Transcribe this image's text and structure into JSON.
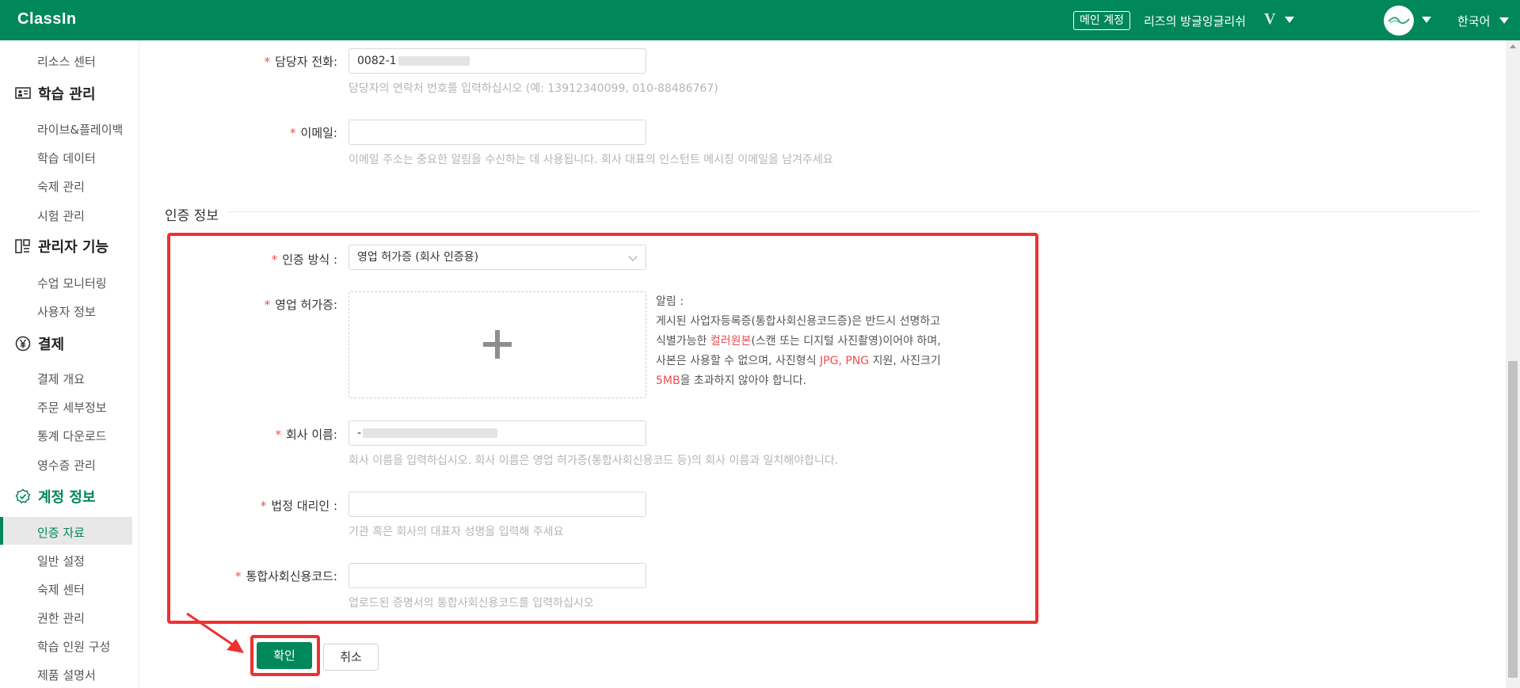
{
  "header": {
    "logo": "ClassIn",
    "main_account_badge": "메인 계정",
    "account_name": "리즈의 방글잉글리쉬",
    "account_level": "V",
    "language": "한국어"
  },
  "sidebar": {
    "top_item": "리소스 센터",
    "groups": [
      {
        "title": "학습 관리",
        "icon": "classroom-icon",
        "items": [
          "라이브&플레이백",
          "학습 데이터",
          "숙제 관리",
          "시험 관리"
        ]
      },
      {
        "title": "관리자 기능",
        "icon": "admin-tools-icon",
        "items": [
          "수업 모니터링",
          "사용자 정보"
        ]
      },
      {
        "title": "결제",
        "icon": "yen-icon",
        "items": [
          "결제 개요",
          "주문 세부정보",
          "통계 다운로드",
          "영수증 관리"
        ]
      },
      {
        "title": "계정 정보",
        "icon": "account-shield-icon",
        "items": [
          "인증 자료",
          "일반 설정",
          "숙제 센터",
          "권한 관리",
          "학습 인원 구성",
          "제품 설명서"
        ]
      }
    ],
    "active_item": "인증 자료"
  },
  "form": {
    "contact_phone": {
      "label": "담당자 전화:",
      "value": "0082-1",
      "hint": "담당자의 연락처 번호를 입력하십시오 (예: 13912340099, 010-88486767)"
    },
    "email": {
      "label": "이메일:",
      "value": "",
      "hint": "이메일 주소는 중요한 알림을 수신하는 데 사용됩니다. 회사 대표의 인스턴트 메시징 이메일을 남겨주세요"
    },
    "section_title": "인증 정보",
    "auth_method": {
      "label": "인증 방식 :",
      "value": "영업 허가증 (회사 인증용)"
    },
    "business_license": {
      "label": "영업 허가증:",
      "notice_title": "알림 :",
      "notice_line1": "게시된 사업자등록증(통합사회신용코드증)은 반드시 선명하고",
      "notice_line2_pre": "식별가능한 ",
      "notice_line2_hl": "컬러원본",
      "notice_line2_post": "(스캔 또는 디지털 사진촬영)이어야 하며,",
      "notice_line3_pre": "사본은 사용할 수 없으며, 사진형식 ",
      "notice_line3_hl": "JPG, PNG",
      "notice_line3_post": " 지원, 사진크기",
      "notice_line4_hl": "5MB",
      "notice_line4_post": "을 초과하지 않아야 합니다."
    },
    "company_name": {
      "label": "회사 이름:",
      "value": "-",
      "hint": "회사 이름을 입력하십시오. 회사 이름은 영업 허가증(통합사회신용코드 등)의 회사 이름과 일치해야합니다."
    },
    "legal_rep": {
      "label": "법정 대리인 :",
      "value": "",
      "hint": "기관 혹은 회사의 대표자 성명을 입력해 주세요"
    },
    "credit_code": {
      "label": "통합사회신용코드:",
      "value": "",
      "hint": "업로드된 증명서의 통합사회신용코드를 입력하십시오"
    },
    "required_mark": "*",
    "confirm_label": "확인",
    "cancel_label": "취소"
  },
  "colors": {
    "brand": "#00875a",
    "highlight": "#f03030",
    "required": "#f04d4d"
  }
}
